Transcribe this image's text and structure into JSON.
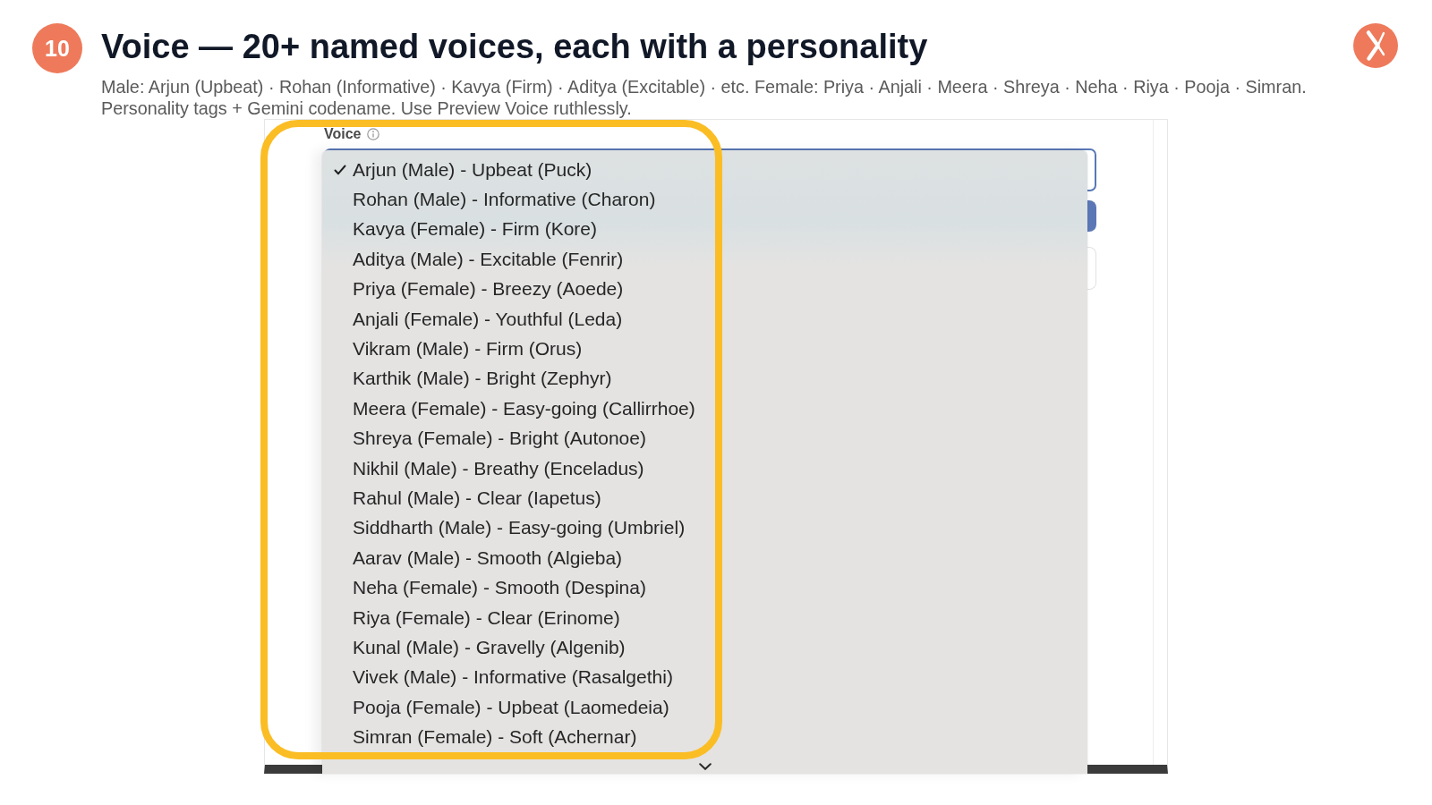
{
  "slide": {
    "number": "10",
    "title": "Voice — 20+ named voices, each with a personality",
    "subtitle_lines": [
      "Male: Arjun (Upbeat) · Rohan (Informative) · Kavya (Firm) · Aditya (Excitable) · etc. Female: Priya · Anjali · Meera · Shreya · Neha · Riya · Pooja · Simran.",
      "Personality tags + Gemini codename. Use Preview Voice ruthlessly."
    ]
  },
  "voice_field": {
    "label": "Voice",
    "options": [
      {
        "label": "Arjun (Male) - Upbeat (Puck)",
        "selected": true
      },
      {
        "label": "Rohan (Male) - Informative (Charon)",
        "selected": false
      },
      {
        "label": "Kavya (Female) - Firm (Kore)",
        "selected": false
      },
      {
        "label": "Aditya (Male) - Excitable (Fenrir)",
        "selected": false
      },
      {
        "label": "Priya (Female) - Breezy (Aoede)",
        "selected": false
      },
      {
        "label": "Anjali (Female) - Youthful (Leda)",
        "selected": false
      },
      {
        "label": "Vikram (Male) - Firm (Orus)",
        "selected": false
      },
      {
        "label": "Karthik (Male) - Bright (Zephyr)",
        "selected": false
      },
      {
        "label": "Meera (Female) - Easy-going (Callirrhoe)",
        "selected": false
      },
      {
        "label": "Shreya (Female) - Bright (Autonoe)",
        "selected": false
      },
      {
        "label": "Nikhil (Male) - Breathy (Enceladus)",
        "selected": false
      },
      {
        "label": "Rahul (Male) - Clear (Iapetus)",
        "selected": false
      },
      {
        "label": "Siddharth (Male) - Easy-going (Umbriel)",
        "selected": false
      },
      {
        "label": "Aarav (Male) - Smooth (Algieba)",
        "selected": false
      },
      {
        "label": "Neha (Female) - Smooth (Despina)",
        "selected": false
      },
      {
        "label": "Riya (Female) - Clear (Erinome)",
        "selected": false
      },
      {
        "label": "Kunal (Male) - Gravelly (Algenib)",
        "selected": false
      },
      {
        "label": "Vivek (Male) - Informative (Rasalgethi)",
        "selected": false
      },
      {
        "label": "Pooja (Female) - Upbeat (Laomedeia)",
        "selected": false
      },
      {
        "label": "Simran (Female) - Soft (Achernar)",
        "selected": false
      }
    ]
  }
}
